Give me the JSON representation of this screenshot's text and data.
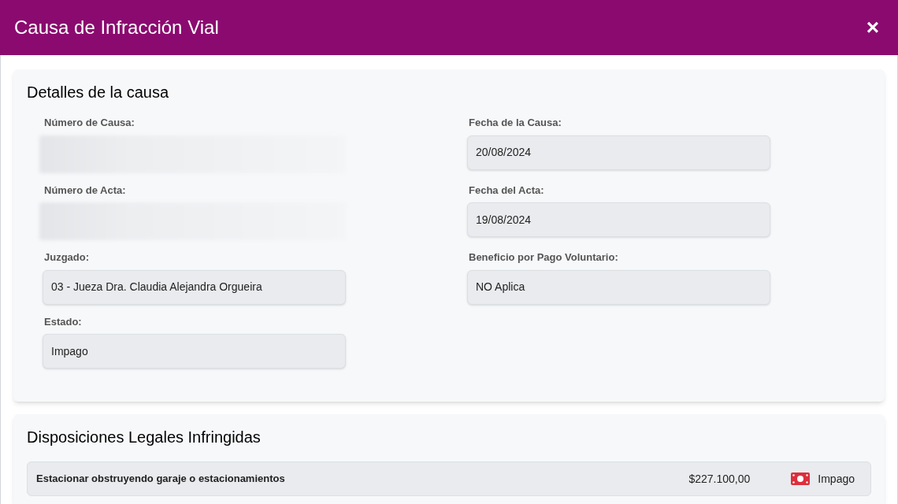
{
  "window": {
    "title": "Causa de Infracción Vial",
    "close": "×"
  },
  "details": {
    "title": "Detalles de la causa",
    "fields": [
      {
        "label": "Número de Causa:",
        "redacted": true
      },
      {
        "label": "Fecha de la Causa:",
        "value": "20/08/2024"
      },
      {
        "label": "Número de Acta:",
        "redacted": true
      },
      {
        "label": "Fecha del Acta:",
        "value": "19/08/2024"
      },
      {
        "label": "Juzgado:",
        "value": "03 - Jueza Dra. Claudia Alejandra Orgueira"
      },
      {
        "label": "Beneficio por Pago Voluntario:",
        "value": "NO Aplica"
      },
      {
        "label": "Estado:",
        "value": "Impago"
      }
    ]
  },
  "dispositions": {
    "title": "Disposiciones Legales Infringidas",
    "rows": [
      {
        "description": "Estacionar obstruyendo garaje o estacionamientos",
        "amount": "$227.100,00",
        "status": "Impago",
        "paid": false
      }
    ]
  }
}
